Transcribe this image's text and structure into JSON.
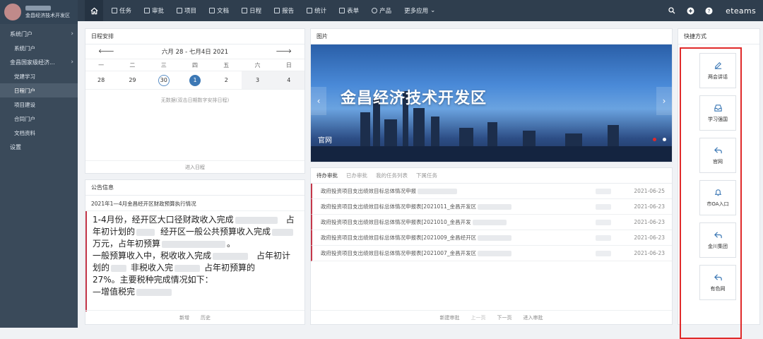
{
  "sidebar": {
    "user_subtitle": "金昌经济技术开发区",
    "items": [
      {
        "label": "系统门户",
        "level": 1,
        "chevron": true
      },
      {
        "label": "系统门户",
        "level": 2
      },
      {
        "label": "金昌国家级经济...",
        "level": 1,
        "chevron": true
      },
      {
        "label": "党建学习",
        "level": 2
      },
      {
        "label": "日程门户",
        "level": 2,
        "active": true
      },
      {
        "label": "项目建设",
        "level": 2
      },
      {
        "label": "合同门户",
        "level": 2
      },
      {
        "label": "文档资料",
        "level": 2
      },
      {
        "label": "设置",
        "level": 1
      }
    ]
  },
  "topbar": {
    "nav": [
      "任务",
      "审批",
      "项目",
      "文档",
      "日程",
      "报告",
      "统计",
      "表单",
      "产品",
      "更多应用"
    ],
    "brand": "eteams"
  },
  "schedule": {
    "title": "日程安排",
    "range": "六月 28 - 七月4日  2021",
    "weekdays": [
      "一",
      "二",
      "三",
      "四",
      "五",
      "六",
      "日"
    ],
    "days": [
      "28",
      "29",
      "30",
      "1",
      "2",
      "3",
      "4"
    ],
    "empty": "无数据(双击日期数字安排日程)",
    "footer": "进入日程"
  },
  "notice": {
    "title": "公告信息",
    "headline": "2021年1—4月金昌经开区财政预算执行情况",
    "lines": [
      "1-4月份，经开区大口径财政收入完成",
      "年初计划的",
      "万元，占年初预算",
      "一般预算收入中，税收收入完成",
      "划的",
      "27%。主要税种完成情况如下：",
      "—增值税完"
    ],
    "line_parts": {
      "l1_tail": "占",
      "l2_mid": "经开区一般公共预算收入完成",
      "l4_tail": "占年初计",
      "l5_mid": "非税收入完",
      "l5_tail": "占年初预算的"
    },
    "footer_add": "新增",
    "footer_more": "历史"
  },
  "picture": {
    "title": "图片",
    "banner_text": "金昌经济技术开发区",
    "caption": "官网",
    "dot_active": "#e02a2a",
    "dot_inactive": "#ffffff"
  },
  "todo": {
    "tabs": [
      "待办审批",
      "已办审批",
      "我的任务列表",
      "下属任务"
    ],
    "rows": [
      {
        "title": "政府投资项目支出绩效目标总体情况申报",
        "date": "2021-06-25"
      },
      {
        "title": "政府投资项目支出绩效目标总体情况申报表[2021011_金昌开发区",
        "date": "2021-06-23"
      },
      {
        "title": "政府投资项目支出绩效目标总体情况申报表[2021010_金昌开发",
        "date": "2021-06-23"
      },
      {
        "title": "政府投资项目支出绩效目标总体情况申报表[2021009_金昌经开区",
        "date": "2021-06-23"
      },
      {
        "title": "政府投资项目支出绩效目标总体情况申报表[2021007_金昌开发区",
        "date": "2021-06-23"
      }
    ],
    "footer": [
      "新建审批",
      "上一页",
      "下一页",
      "进入审批"
    ]
  },
  "quick": {
    "title": "快捷方式",
    "items": [
      {
        "label": "两会讲话",
        "icon": "edit-icon"
      },
      {
        "label": "学习强国",
        "icon": "inbox-icon"
      },
      {
        "label": "官网",
        "icon": "reply-arrow-icon"
      },
      {
        "label": "市OA入口",
        "icon": "bell-icon"
      },
      {
        "label": "金川集团",
        "icon": "reply-arrow-icon"
      },
      {
        "label": "有色网",
        "icon": "reply-arrow-icon"
      }
    ]
  },
  "colors": {
    "accent": "#3c78b5",
    "highlight_border": "#e02a2a",
    "row_marker": "#c5384a"
  }
}
